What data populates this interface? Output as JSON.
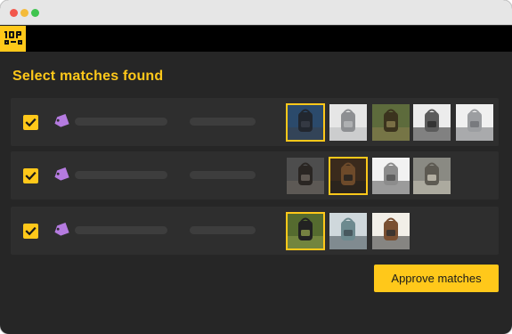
{
  "window": {
    "controls": [
      "close",
      "minimize",
      "maximize"
    ]
  },
  "app": {
    "logo_text": "10P",
    "accent": "#ffc81a"
  },
  "page": {
    "title": "Select matches found"
  },
  "rows": [
    {
      "checked": true,
      "thumbnails": [
        {
          "selected": true,
          "palette": [
            "#2b4a6b",
            "#22272f",
            "#3a3f48"
          ]
        },
        {
          "selected": false,
          "palette": [
            "#e6e6e6",
            "#8d8f92",
            "#b7b8ba"
          ]
        },
        {
          "selected": false,
          "palette": [
            "#5d6b3c",
            "#3b331e",
            "#8a7d4f"
          ]
        },
        {
          "selected": false,
          "palette": [
            "#ececec",
            "#5b5b5b",
            "#2a2a2a"
          ]
        },
        {
          "selected": false,
          "palette": [
            "#f0f0f0",
            "#9c9ea1",
            "#6f7175"
          ]
        }
      ]
    },
    {
      "checked": true,
      "thumbnails": [
        {
          "selected": false,
          "palette": [
            "#4d4d4d",
            "#2a2623",
            "#6b645c"
          ]
        },
        {
          "selected": true,
          "palette": [
            "#3a2a1c",
            "#6d4a2a",
            "#1f1f1f"
          ]
        },
        {
          "selected": false,
          "palette": [
            "#f2f2f2",
            "#8c8c8c",
            "#545454"
          ]
        },
        {
          "selected": false,
          "palette": [
            "#8a8a83",
            "#5d5a52",
            "#c9c4b7"
          ]
        }
      ]
    },
    {
      "checked": true,
      "thumbnails": [
        {
          "selected": true,
          "palette": [
            "#556b2f",
            "#222222",
            "#8b9a4a"
          ]
        },
        {
          "selected": false,
          "palette": [
            "#cfd8dc",
            "#6d8a8f",
            "#3f4c52"
          ]
        },
        {
          "selected": false,
          "palette": [
            "#f2efe8",
            "#7a5032",
            "#2e2e2e"
          ]
        }
      ]
    }
  ],
  "actions": {
    "approve_label": "Approve matches"
  },
  "colors": {
    "panel": "#262626",
    "row": "#2e2e2e",
    "tag": "#b57be0",
    "selection": "#ffc81a"
  }
}
